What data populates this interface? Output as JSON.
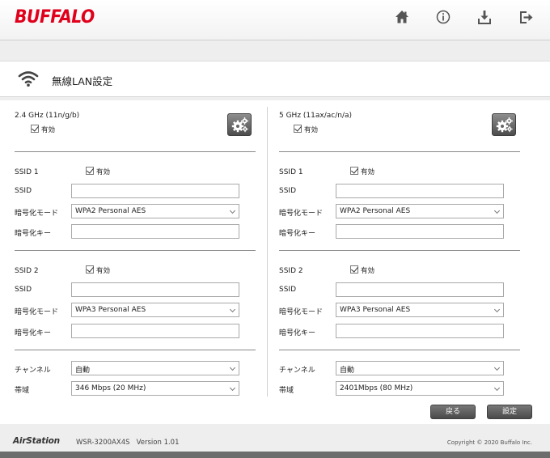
{
  "header": {
    "logo": "BUFFALO",
    "icons": [
      "home-icon",
      "info-icon",
      "download-icon",
      "logout-icon"
    ]
  },
  "page": {
    "title": "無線LAN設定"
  },
  "bands": [
    {
      "label": "2.4 GHz (11n/g/b)",
      "enabled_label": "有効",
      "ssid1": {
        "heading": "SSID 1",
        "enabled_label": "有効",
        "ssid_label": "SSID",
        "ssid_value": "",
        "mode_label": "暗号化モード",
        "mode_value": "WPA2 Personal AES",
        "key_label": "暗号化キー",
        "key_value": ""
      },
      "ssid2": {
        "heading": "SSID 2",
        "enabled_label": "有効",
        "ssid_label": "SSID",
        "ssid_value": "",
        "mode_label": "暗号化モード",
        "mode_value": "WPA3 Personal AES",
        "key_label": "暗号化キー",
        "key_value": ""
      },
      "channel_label": "チャンネル",
      "channel_value": "自動",
      "bandwidth_label": "帯域",
      "bandwidth_value": "346 Mbps (20 MHz)"
    },
    {
      "label": "5 GHz (11ax/ac/n/a)",
      "enabled_label": "有効",
      "ssid1": {
        "heading": "SSID 1",
        "enabled_label": "有効",
        "ssid_label": "SSID",
        "ssid_value": "",
        "mode_label": "暗号化モード",
        "mode_value": "WPA2 Personal AES",
        "key_label": "暗号化キー",
        "key_value": ""
      },
      "ssid2": {
        "heading": "SSID 2",
        "enabled_label": "有効",
        "ssid_label": "SSID",
        "ssid_value": "",
        "mode_label": "暗号化モード",
        "mode_value": "WPA3 Personal AES",
        "key_label": "暗号化キー",
        "key_value": ""
      },
      "channel_label": "チャンネル",
      "channel_value": "自動",
      "bandwidth_label": "帯域",
      "bandwidth_value": "2401Mbps (80 MHz)"
    }
  ],
  "actions": {
    "back_label": "戻る",
    "save_label": "設定"
  },
  "footer": {
    "brand": "AirStation",
    "model": "WSR-3200AX4S   Version 1.01",
    "copyright": "Copyright © 2020 Buffalo Inc."
  },
  "colors": {
    "logo": "#e0001b",
    "button": "#555555",
    "background": "#eeeeee"
  }
}
